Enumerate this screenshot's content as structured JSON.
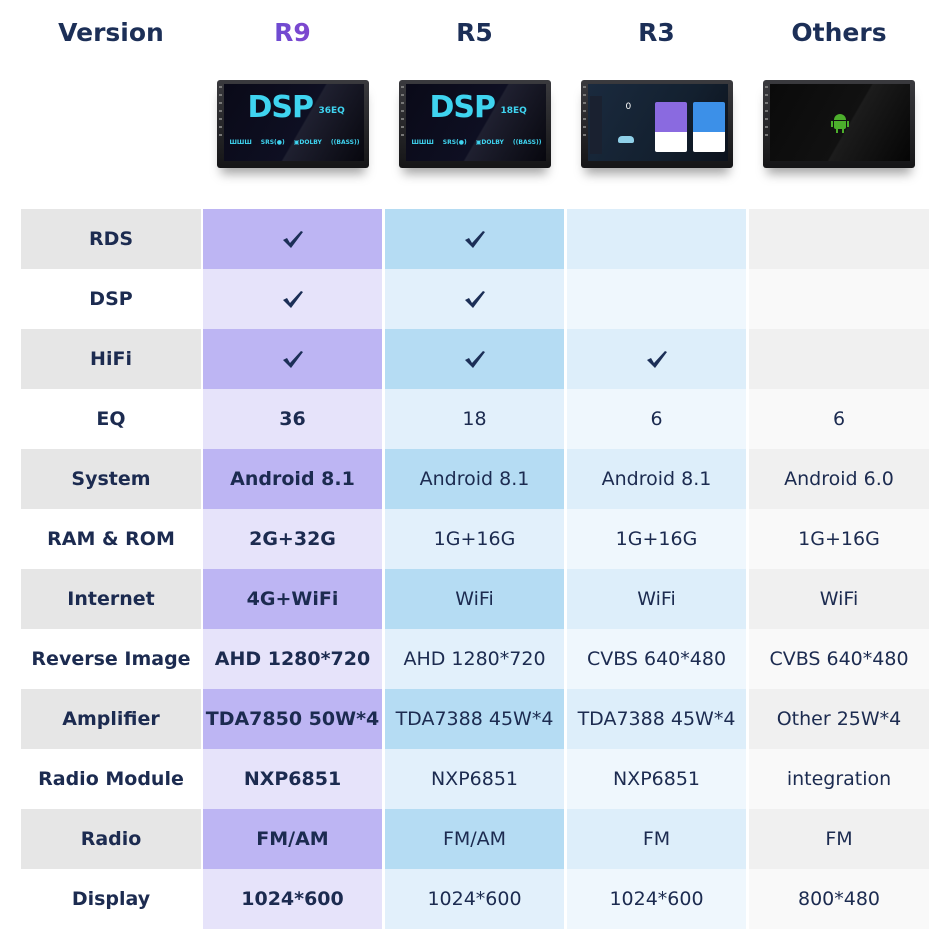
{
  "header": {
    "version_label": "Version",
    "columns": [
      {
        "name": "R9",
        "screen": "dsp",
        "dsp_text": "DSP",
        "eq_text": "36EQ",
        "logos": [
          "ШШШ",
          "SRS(●)",
          "▣DOLBY",
          "((BASS))"
        ]
      },
      {
        "name": "R5",
        "screen": "dsp",
        "dsp_text": "DSP",
        "eq_text": "18EQ",
        "logos": [
          "ШШШ",
          "SRS(●)",
          "▣DOLBY",
          "((BASS))"
        ]
      },
      {
        "name": "R3",
        "screen": "launcher",
        "speed": "0"
      },
      {
        "name": "Others",
        "screen": "android-logo"
      }
    ]
  },
  "accent_colors": {
    "title_text": "#1c2f57",
    "r9_gradient": [
      "#4a56d8",
      "#a23cc8"
    ],
    "r9_column": "#bdb5f3",
    "r5_column": "#b5dcf3",
    "check_color": "#1c2f57"
  },
  "rows": [
    {
      "label": "RDS",
      "values": [
        {
          "check": true
        },
        {
          "check": true
        },
        {
          "check": false
        },
        {
          "check": false
        }
      ]
    },
    {
      "label": "DSP",
      "values": [
        {
          "check": true
        },
        {
          "check": true
        },
        {
          "check": false
        },
        {
          "check": false
        }
      ]
    },
    {
      "label": "HiFi",
      "values": [
        {
          "check": true
        },
        {
          "check": true
        },
        {
          "check": true
        },
        {
          "check": false
        }
      ]
    },
    {
      "label": "EQ",
      "values": [
        {
          "text": "36"
        },
        {
          "text": "18"
        },
        {
          "text": "6"
        },
        {
          "text": "6"
        }
      ]
    },
    {
      "label": "System",
      "values": [
        {
          "text": "Android 8.1"
        },
        {
          "text": "Android 8.1"
        },
        {
          "text": "Android 8.1"
        },
        {
          "text": "Android 6.0"
        }
      ]
    },
    {
      "label": "RAM & ROM",
      "values": [
        {
          "text": "2G+32G"
        },
        {
          "text": "1G+16G"
        },
        {
          "text": "1G+16G"
        },
        {
          "text": "1G+16G"
        }
      ]
    },
    {
      "label": "Internet",
      "values": [
        {
          "text": "4G+WiFi"
        },
        {
          "text": "WiFi"
        },
        {
          "text": "WiFi"
        },
        {
          "text": "WiFi"
        }
      ]
    },
    {
      "label": "Reverse Image",
      "values": [
        {
          "text": "AHD 1280*720"
        },
        {
          "text": "AHD 1280*720"
        },
        {
          "text": "CVBS 640*480"
        },
        {
          "text": "CVBS 640*480"
        }
      ]
    },
    {
      "label": "Amplifier",
      "values": [
        {
          "text": "TDA7850 50W*4"
        },
        {
          "text": "TDA7388 45W*4"
        },
        {
          "text": "TDA7388 45W*4"
        },
        {
          "text": "Other 25W*4"
        }
      ]
    },
    {
      "label": "Radio Module",
      "values": [
        {
          "text": "NXP6851"
        },
        {
          "text": "NXP6851"
        },
        {
          "text": "NXP6851"
        },
        {
          "text": "integration"
        }
      ]
    },
    {
      "label": "Radio",
      "values": [
        {
          "text": "FM/AM"
        },
        {
          "text": "FM/AM"
        },
        {
          "text": "FM"
        },
        {
          "text": "FM"
        }
      ]
    },
    {
      "label": "Display",
      "values": [
        {
          "text": "1024*600"
        },
        {
          "text": "1024*600"
        },
        {
          "text": "1024*600"
        },
        {
          "text": "800*480"
        }
      ]
    }
  ]
}
